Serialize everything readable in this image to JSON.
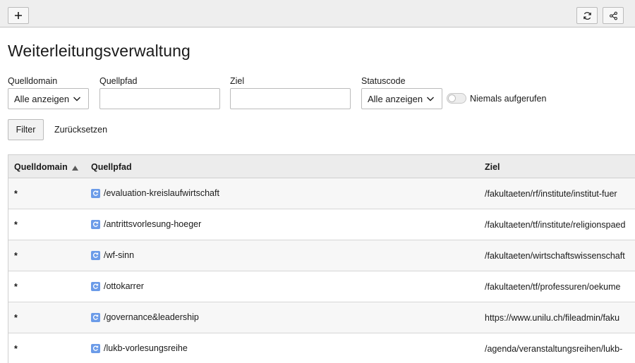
{
  "toolbar": {
    "add_icon": "plus-icon",
    "reload_icon": "reload-icon",
    "share_icon": "share-icon"
  },
  "page_title": "Weiterleitungsverwaltung",
  "filters": {
    "source_domain": {
      "label": "Quelldomain",
      "value": "Alle anzeigen"
    },
    "source_path": {
      "label": "Quellpfad",
      "value": ""
    },
    "target": {
      "label": "Ziel",
      "value": ""
    },
    "status_code": {
      "label": "Statuscode",
      "value": "Alle anzeigen"
    },
    "never_called": {
      "label": "Niemals aufgerufen",
      "checked": false
    },
    "filter_button": "Filter",
    "reset_button": "Zurücksetzen"
  },
  "table": {
    "headers": {
      "source_domain": "Quelldomain",
      "source_path": "Quellpfad",
      "target": "Ziel"
    },
    "sort_icon": "sort-ascending-icon",
    "rows": [
      {
        "domain": "*",
        "path": "/evaluation-kreislaufwirtschaft",
        "target": "/fakultaeten/rf/institute/institut-fuer"
      },
      {
        "domain": "*",
        "path": "/antrittsvorlesung-hoeger",
        "target": "/fakultaeten/tf/institute/religionspaed"
      },
      {
        "domain": "*",
        "path": "/wf-sinn",
        "target": "/fakultaeten/wirtschaftswissenschaft"
      },
      {
        "domain": "*",
        "path": "/ottokarrer",
        "target": "/fakultaeten/tf/professuren/oekume"
      },
      {
        "domain": "*",
        "path": "/governance&leadership",
        "target": "https://www.unilu.ch/fileadmin/faku"
      },
      {
        "domain": "*",
        "path": "/lukb-vorlesungsreihe",
        "target": "/agenda/veranstaltungsreihen/lukb-"
      }
    ]
  },
  "colors": {
    "toolbar_bg": "#eeeeee",
    "header_bg": "#ececec",
    "page_icon": "#6b9be8"
  }
}
